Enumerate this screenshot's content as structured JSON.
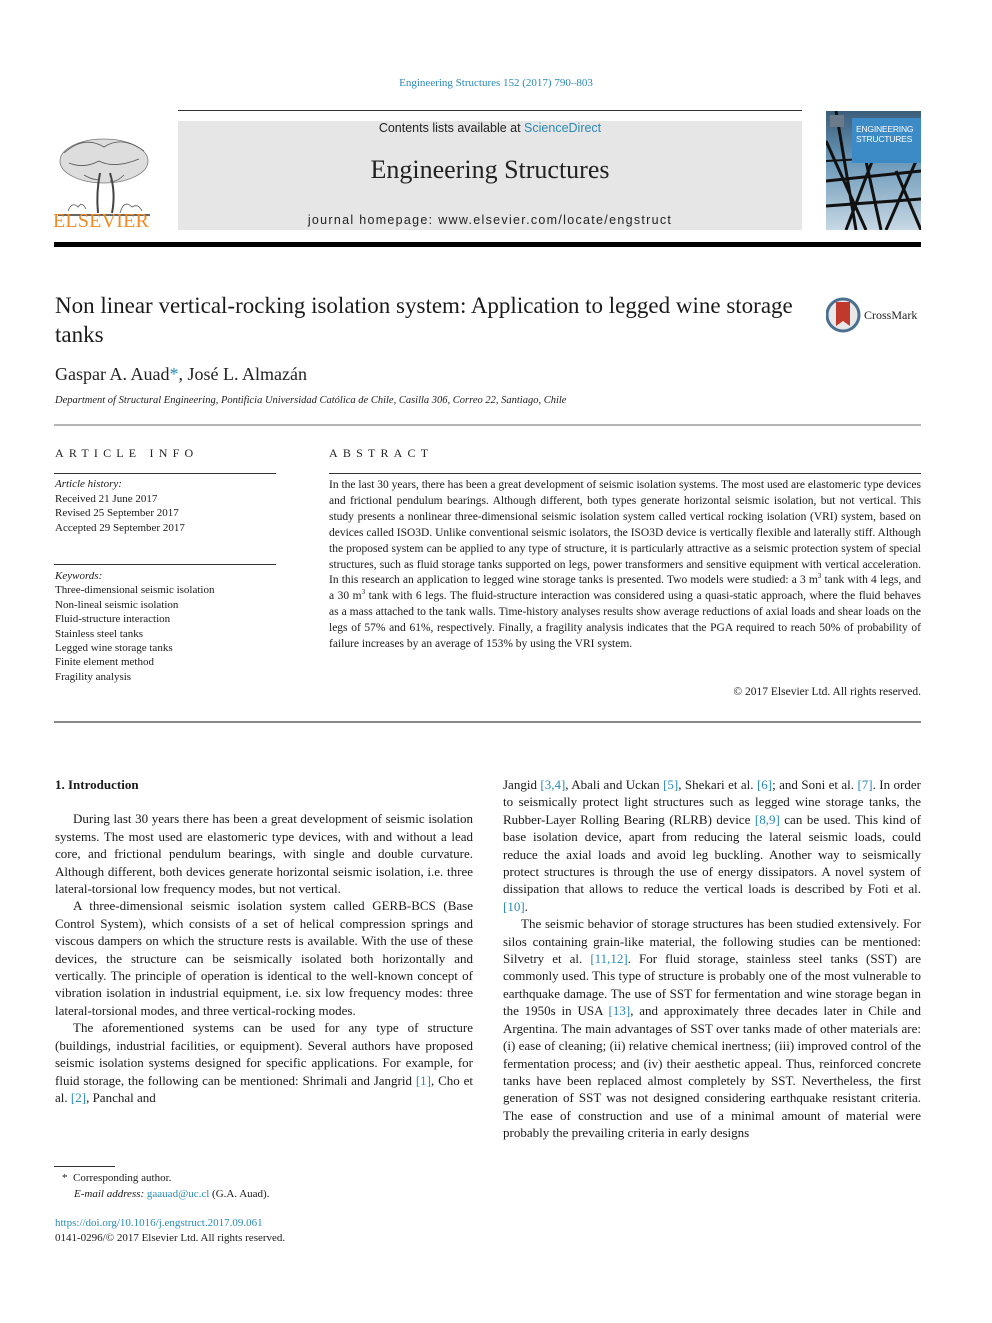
{
  "citation": "Engineering Structures 152 (2017) 790–803",
  "header": {
    "contents_prefix": "Contents lists available at ",
    "contents_link": "ScienceDirect",
    "journal_name": "Engineering Structures",
    "homepage_prefix": "journal homepage: ",
    "homepage_url": "www.elsevier.com/locate/engstruct",
    "publisher_logo_text": "ELSEVIER",
    "cover_title_line1": "ENGINEERING",
    "cover_title_line2": "STRUCTURES"
  },
  "article": {
    "title": "Non linear vertical-rocking isolation system: Application to legged wine storage tanks",
    "crossmark_label": "CrossMark",
    "authors": [
      {
        "name": "Gaspar A. Auad",
        "mark": "*"
      },
      {
        "name": "José L. Almazán",
        "mark": ""
      }
    ],
    "author_separator": ", ",
    "affiliation": "Department of Structural Engineering, Pontificia Universidad Católica de Chile, Casilla 306, Correo 22, Santiago, Chile"
  },
  "article_info": {
    "heading": "ARTICLE INFO",
    "history_label": "Article history:",
    "history": [
      "Received 21 June 2017",
      "Revised 25 September 2017",
      "Accepted 29 September 2017"
    ],
    "keywords_label": "Keywords:",
    "keywords": [
      "Three-dimensional seismic isolation",
      "Non-lineal seismic isolation",
      "Fluid-structure interaction",
      "Stainless steel tanks",
      "Legged wine storage tanks",
      "Finite element method",
      "Fragility analysis"
    ]
  },
  "abstract": {
    "heading": "ABSTRACT",
    "text_part1": "In the last 30 years, there has been a great development of seismic isolation systems. The most used are elastomeric type devices and frictional pendulum bearings. Although different, both types generate horizontal seismic isolation, but not vertical. This study presents a nonlinear three-dimensional seismic isolation system called vertical rocking isolation (VRI) system, based on devices called ISO3D. Unlike conventional seismic isolators, the ISO3D device is vertically flexible and laterally stiff. Although the proposed system can be applied to any type of structure, it is particularly attractive as a seismic protection system of special structures, such as fluid storage tanks supported on legs, power transformers and sensitive equipment with vertical acceleration. In this research an application to legged wine storage tanks is presented. Two models were studied: a 3 m",
    "sup1": "3",
    "text_part2": " tank with 4 legs, and a 30 m",
    "sup2": "3",
    "text_part3": " tank with 6 legs. The fluid-structure interaction was considered using a quasi-static approach, where the fluid behaves as a mass attached to the tank walls. Time-history analyses results show average reductions of axial loads and shear loads on the legs of 57% and 61%, respectively. Finally, a fragility analysis indicates that the PGA required to reach 50% of probability of failure increases by an average of 153% by using the VRI system.",
    "copyright": "© 2017 Elsevier Ltd. All rights reserved."
  },
  "body": {
    "section_heading": "1. Introduction",
    "left": {
      "p1": "During last 30 years there has been a great development of seismic isolation systems. The most used are elastomeric type devices, with and without a lead core, and frictional pendulum bearings, with single and double curvature. Although different, both devices generate horizontal seismic isolation, i.e. three lateral-torsional low frequency modes, but not vertical.",
      "p2": "A three-dimensional seismic isolation system called GERB-BCS (Base Control System), which consists of a set of helical compression springs and viscous dampers on which the structure rests is available. With the use of these devices, the structure can be seismically isolated both horizontally and vertically. The principle of operation is identical to the well-known concept of vibration isolation in industrial equipment, i.e. six low frequency modes: three lateral-torsional modes, and three vertical-rocking modes.",
      "p3_a": "The aforementioned systems can be used for any type of structure (buildings, industrial facilities, or equipment). Several authors have proposed seismic isolation systems designed for specific applications. For example, for fluid storage, the following can be mentioned: Shrimali and Jangrid ",
      "ref1": "[1]",
      "p3_b": ", Cho et al. ",
      "ref2": "[2]",
      "p3_c": ", Panchal and"
    },
    "right": {
      "p1_a": "Jangid ",
      "ref3": "[3,4]",
      "p1_b": ", Abali and Uckan ",
      "ref5": "[5]",
      "p1_c": ", Shekari et al. ",
      "ref6": "[6]",
      "p1_d": "; and Soni et al. ",
      "ref7": "[7]",
      "p1_e": ". In order to seismically protect light structures such as legged wine storage tanks, the Rubber-Layer Rolling Bearing (RLRB) device ",
      "ref8": "[8,9]",
      "p1_f": " can be used. This kind of base isolation device, apart from reducing the lateral seismic loads, could reduce the axial loads and avoid leg buckling. Another way to seismically protect structures is through the use of energy dissipators. A novel system of dissipation that allows to reduce the vertical loads is described by Foti et al. ",
      "ref10": "[10]",
      "p1_g": ".",
      "p2_a": "The seismic behavior of storage structures has been studied extensively. For silos containing grain-like material, the following studies can be mentioned: Silvetry et al. ",
      "ref11": "[11,12]",
      "p2_b": ". For fluid storage, stainless steel tanks (SST) are commonly used. This type of structure is probably one of the most vulnerable to earthquake damage. The use of SST for fermentation and wine storage began in the 1950s in USA ",
      "ref13": "[13]",
      "p2_c": ", and approximately three decades later in Chile and Argentina. The main advantages of SST over tanks made of other materials are: (i) ease of cleaning; (ii) relative chemical inertness; (iii) improved control of the fermentation process; and (iv) their aesthetic appeal. Thus, reinforced concrete tanks have been replaced almost completely by SST. Nevertheless, the first generation of SST was not designed considering earthquake resistant criteria. The ease of construction and use of a minimal amount of material were probably the prevailing criteria in early designs"
    }
  },
  "footnotes": {
    "star": "*",
    "corresponding": "Corresponding author.",
    "email_label": "E-mail address: ",
    "email": "gaauad@uc.cl",
    "email_suffix": " (G.A. Auad).",
    "doi": "https://doi.org/10.1016/j.engstruct.2017.09.061",
    "issn_copyright": "0141-0296/© 2017 Elsevier Ltd. All rights reserved."
  },
  "colors": {
    "link": "#2a8ab5",
    "elsevier_orange": "#f08a24",
    "header_box": "#e6e6e6",
    "cover_blue": "#3c8ac6",
    "crossmark_red": "#c0392b"
  }
}
